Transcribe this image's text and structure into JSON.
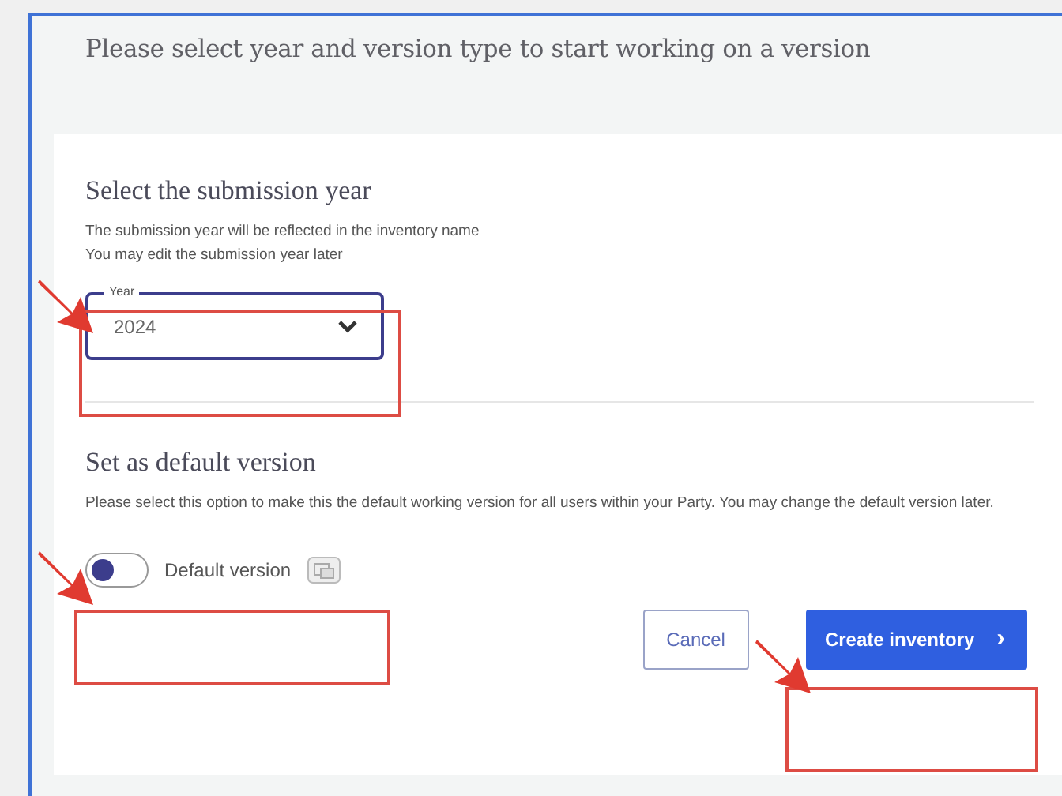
{
  "title": "Please select year and version type to start working on a version",
  "year_section": {
    "heading": "Select the submission year",
    "lines": [
      "The submission year will be reflected in the inventory name",
      "You may edit the submission year later"
    ],
    "field": {
      "label": "Year",
      "value": "2024"
    }
  },
  "default_section": {
    "heading": "Set as default version",
    "description": "Please select this option to make this the default working version for all users within your Party. You may change the default version later.",
    "toggle": {
      "label": "Default version",
      "on": false
    }
  },
  "buttons": [
    {
      "label": "Cancel",
      "kind": "secondary"
    },
    {
      "label": "Create inventory",
      "kind": "primary",
      "icon": "›"
    }
  ]
}
